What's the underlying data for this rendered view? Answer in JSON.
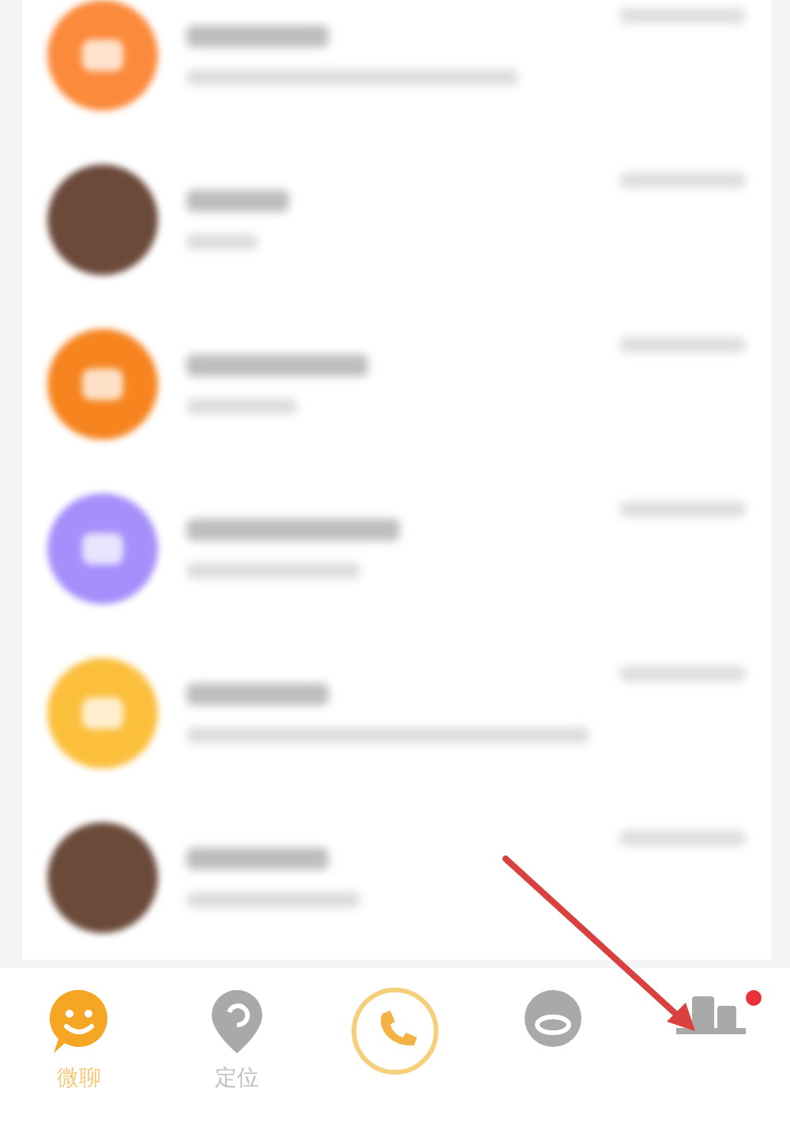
{
  "chats": [
    {
      "kind": "icon",
      "color": "#fb8a3c"
    },
    {
      "kind": "photo"
    },
    {
      "kind": "icon",
      "color": "#f6841f"
    },
    {
      "kind": "icon",
      "color": "#a58ffb"
    },
    {
      "kind": "icon",
      "color": "#fbbf3c"
    },
    {
      "kind": "photo"
    }
  ],
  "tabs": [
    {
      "kind": "chat",
      "label": "微聊",
      "selected": true
    },
    {
      "kind": "location",
      "label": "定位",
      "selected": false
    },
    {
      "kind": "call",
      "selected": false
    },
    {
      "kind": "eye",
      "selected": false
    },
    {
      "kind": "contacts",
      "selected": false,
      "badge": true
    }
  ],
  "annotation": {
    "kind": "arrow"
  }
}
